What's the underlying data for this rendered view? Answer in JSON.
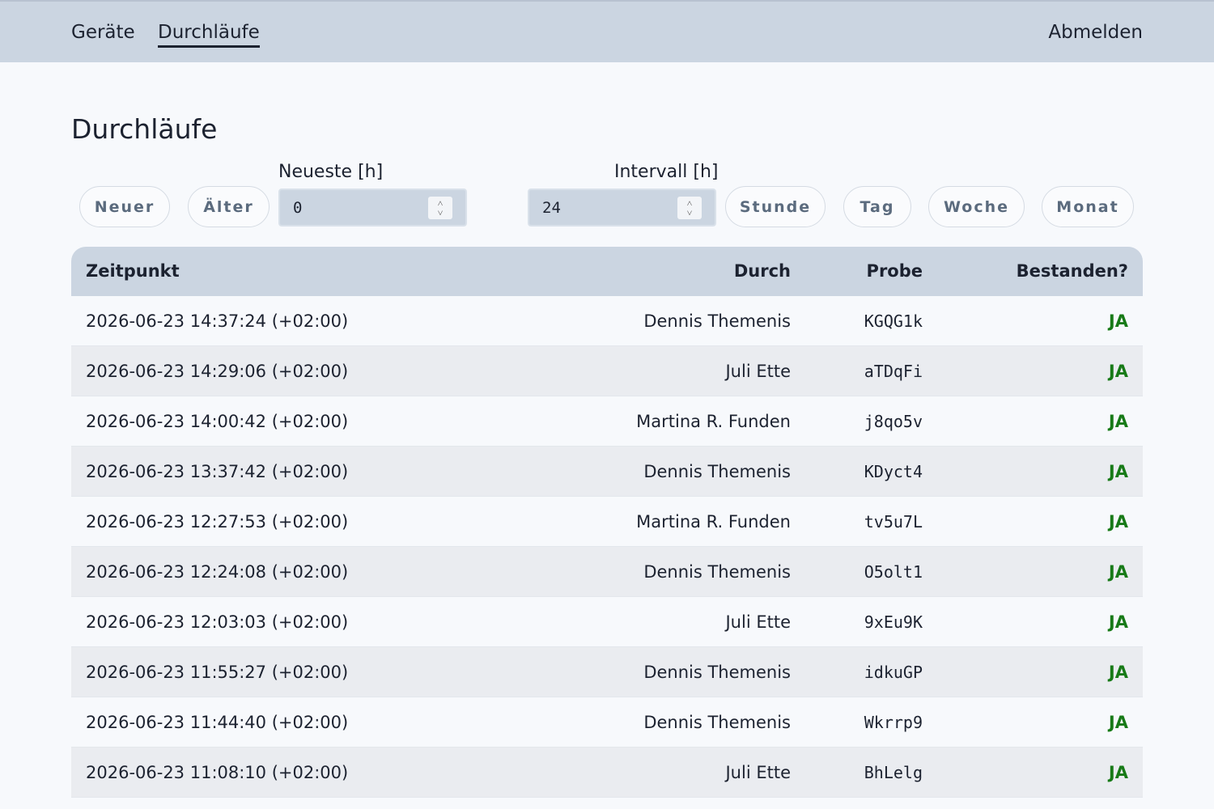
{
  "nav": {
    "geraete": "Geräte",
    "durchlaeufe": "Durchläufe",
    "abmelden": "Abmelden"
  },
  "page_title": "Durchläufe",
  "controls": {
    "neuer": "Neuer",
    "aelter": "Älter",
    "neueste_label": "Neueste [h]",
    "neueste_value": "0",
    "intervall_label": "Intervall [h]",
    "intervall_value": "24",
    "stunde": "Stunde",
    "tag": "Tag",
    "woche": "Woche",
    "monat": "Monat"
  },
  "table": {
    "headers": {
      "zeitpunkt": "Zeitpunkt",
      "durch": "Durch",
      "probe": "Probe",
      "bestanden": "Bestanden?"
    },
    "pass_color": "#177a17",
    "rows": [
      {
        "zeitpunkt": "2026-06-23 14:37:24 (+02:00)",
        "durch": "Dennis Themenis",
        "probe": "KGQG1k",
        "bestanden": "JA"
      },
      {
        "zeitpunkt": "2026-06-23 14:29:06 (+02:00)",
        "durch": "Juli Ette",
        "probe": "aTDqFi",
        "bestanden": "JA"
      },
      {
        "zeitpunkt": "2026-06-23 14:00:42 (+02:00)",
        "durch": "Martina R. Funden",
        "probe": "j8qo5v",
        "bestanden": "JA"
      },
      {
        "zeitpunkt": "2026-06-23 13:37:42 (+02:00)",
        "durch": "Dennis Themenis",
        "probe": "KDyct4",
        "bestanden": "JA"
      },
      {
        "zeitpunkt": "2026-06-23 12:27:53 (+02:00)",
        "durch": "Martina R. Funden",
        "probe": "tv5u7L",
        "bestanden": "JA"
      },
      {
        "zeitpunkt": "2026-06-23 12:24:08 (+02:00)",
        "durch": "Dennis Themenis",
        "probe": "O5olt1",
        "bestanden": "JA"
      },
      {
        "zeitpunkt": "2026-06-23 12:03:03 (+02:00)",
        "durch": "Juli Ette",
        "probe": "9xEu9K",
        "bestanden": "JA"
      },
      {
        "zeitpunkt": "2026-06-23 11:55:27 (+02:00)",
        "durch": "Dennis Themenis",
        "probe": "idkuGP",
        "bestanden": "JA"
      },
      {
        "zeitpunkt": "2026-06-23 11:44:40 (+02:00)",
        "durch": "Dennis Themenis",
        "probe": "Wkrrp9",
        "bestanden": "JA"
      },
      {
        "zeitpunkt": "2026-06-23 11:08:10 (+02:00)",
        "durch": "Juli Ette",
        "probe": "BhLelg",
        "bestanden": "JA"
      }
    ]
  }
}
